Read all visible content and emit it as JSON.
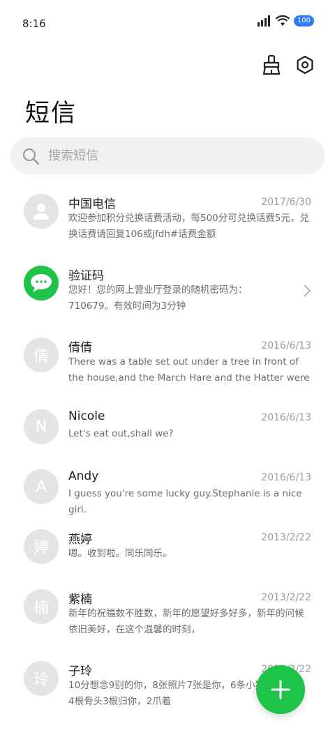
{
  "status_bar": {
    "time": "8:16",
    "battery": "100"
  },
  "title": "短信",
  "search": {
    "placeholder": "搜索短信"
  },
  "conversations": [
    {
      "name": "中国电信",
      "date": "2017/6/30",
      "avatar_text": "",
      "preview": "欢迎参加积分兑换话费活动，每500分可兑换话费5元，兑换话费请回复106或jfdh#话费金额"
    },
    {
      "name": "验证码",
      "date": "",
      "avatar_text": "",
      "preview": "您好！您的网上营业厅登录的随机密码为：710679。有效时间为3分钟"
    },
    {
      "name": "倩倩",
      "date": "2016/6/13",
      "avatar_text": "倩",
      "preview": "There was a table set out under a tree in front of the house,and the March Hare and the Hatter were"
    },
    {
      "name": "Nicole",
      "date": "2016/6/13",
      "avatar_text": "N",
      "preview": "Let's eat out,shall we?"
    },
    {
      "name": "Andy",
      "date": "2016/6/13",
      "avatar_text": "A",
      "preview": "I guess you're some lucky guy.Stephanie is a nice girl."
    },
    {
      "name": "燕婷",
      "date": "2013/2/22",
      "avatar_text": "婷",
      "preview": "嗯。收到啦。同乐同乐。"
    },
    {
      "name": "紫楠",
      "date": "2013/2/22",
      "avatar_text": "楠",
      "preview": "新年的祝福数不胜数，新年的愿望好多好多，新年的问候依旧美好，在这个温馨的时刻，"
    },
    {
      "name": "子玲",
      "date": "2013/2/22",
      "avatar_text": "玲",
      "preview": "10分想念9别的你，8张照片7张是你，6条小狗5只像你，4根骨头3根归你，2爪着"
    }
  ],
  "colors": {
    "accent": "#1ec34a",
    "battery": "#2f7bf6"
  }
}
